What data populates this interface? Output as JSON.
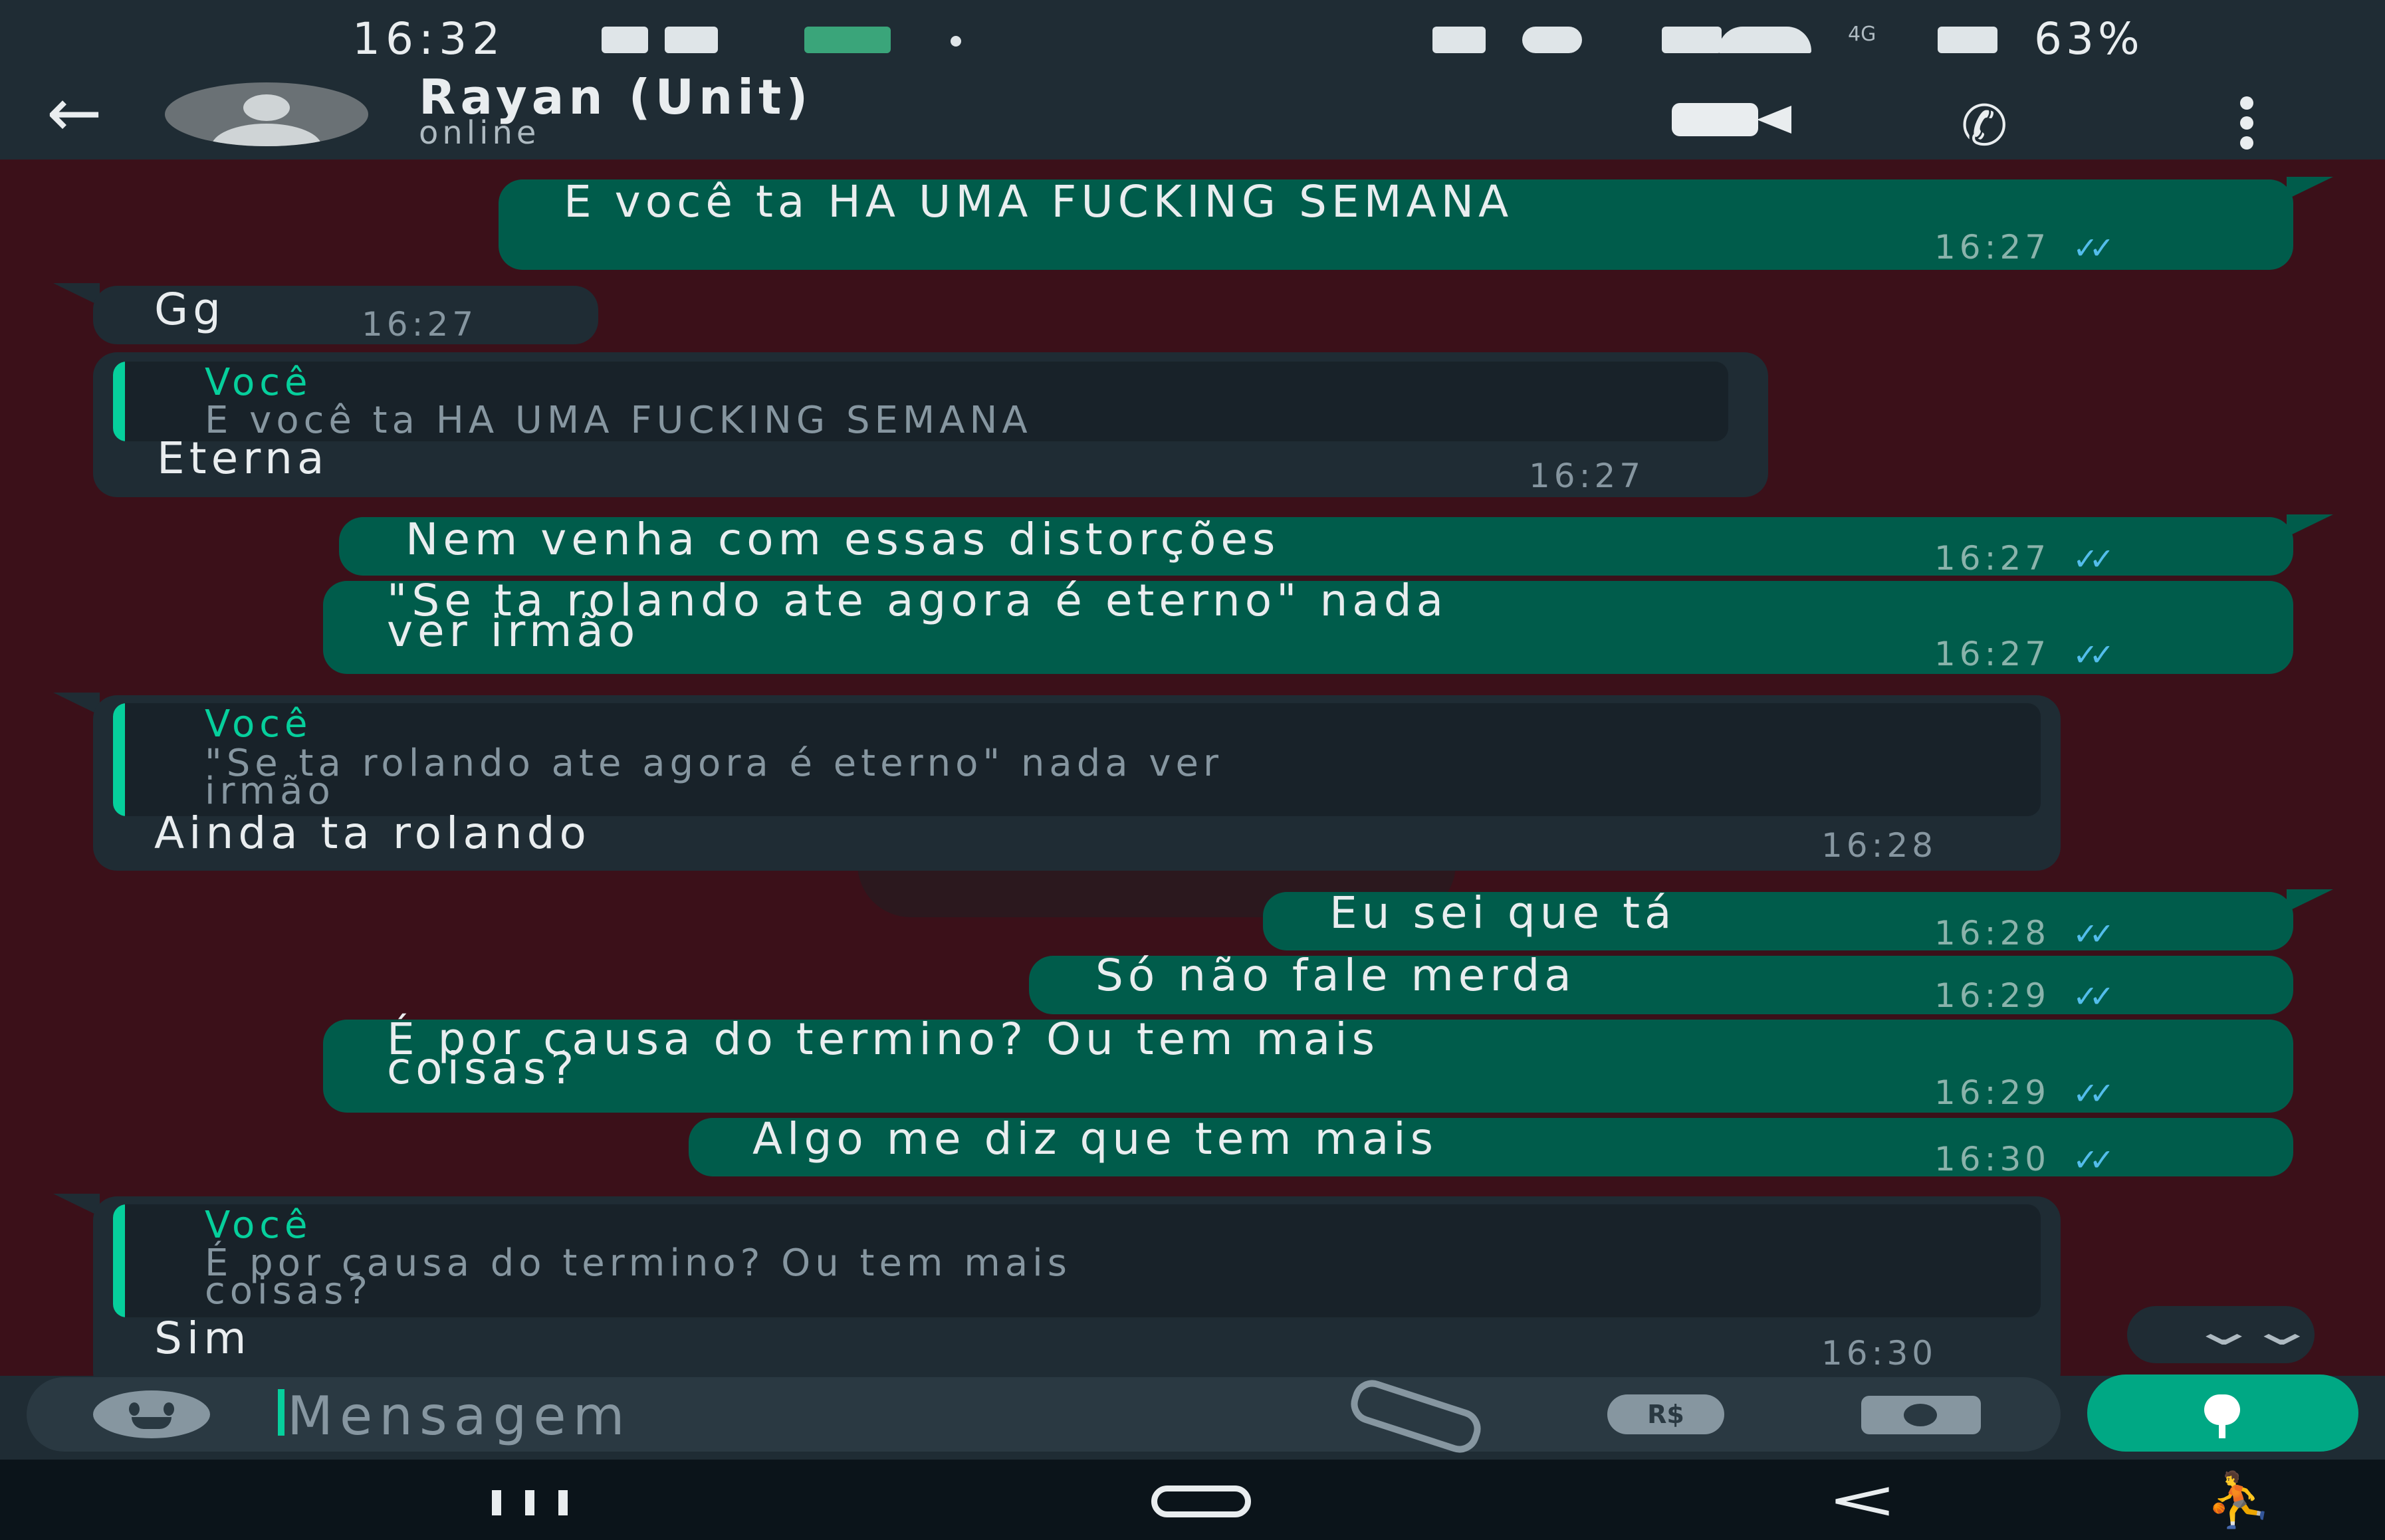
{
  "status_bar": {
    "time": "16:32",
    "network": "4G",
    "battery": "63%"
  },
  "header": {
    "contact_name": "Rayan (Unit)",
    "contact_status": "online"
  },
  "messages": [
    {
      "direction": "out",
      "text": "E você ta HA UMA FUCKING SEMANA",
      "time": "16:27",
      "status": "read"
    },
    {
      "direction": "in",
      "text": "Gg",
      "time": "16:27"
    },
    {
      "direction": "in",
      "quote": {
        "author": "Você",
        "text": "E você ta HA UMA FUCKING SEMANA"
      },
      "text": "Eterna",
      "time": "16:27"
    },
    {
      "direction": "out",
      "text": "Nem venha com essas distorções",
      "time": "16:27",
      "status": "read"
    },
    {
      "direction": "out",
      "text_lines": [
        "\"Se ta rolando ate agora é eterno\" nada",
        "ver irmão"
      ],
      "time": "16:27",
      "status": "read"
    },
    {
      "direction": "in",
      "quote": {
        "author": "Você",
        "text_lines": [
          "\"Se ta rolando ate agora é eterno\" nada ver",
          "irmão"
        ]
      },
      "text": "Ainda ta rolando",
      "time": "16:28"
    },
    {
      "direction": "out",
      "text": "Eu sei que tá",
      "time": "16:28",
      "status": "read"
    },
    {
      "direction": "out",
      "text": "Só não fale merda",
      "time": "16:29",
      "status": "read"
    },
    {
      "direction": "out",
      "text_lines": [
        "É por causa do termino? Ou tem mais",
        "coisas?"
      ],
      "time": "16:29",
      "status": "read"
    },
    {
      "direction": "out",
      "text": "Algo me diz que tem mais",
      "time": "16:30",
      "status": "read"
    },
    {
      "direction": "in",
      "quote": {
        "author": "Você",
        "text_lines": [
          "É por causa do termino? Ou tem mais",
          "coisas?"
        ]
      },
      "text": "Sim",
      "time": "16:30"
    }
  ],
  "input": {
    "placeholder": "Mensagem",
    "value": ""
  },
  "icons": {
    "back": "arrow-left-icon",
    "video": "video-call-icon",
    "call": "phone-icon",
    "menu": "more-vert-icon",
    "emoji": "emoji-icon",
    "attach": "paperclip-icon",
    "payment": "pix-payment-icon",
    "camera": "camera-icon",
    "mic": "mic-icon",
    "scroll": "double-chevron-down-icon"
  },
  "payment_icon_label": "R$",
  "colors": {
    "header_bg": "#1f2c34",
    "chat_wallpaper": "#3b1019",
    "outgoing_bubble": "#005c4b",
    "incoming_bubble": "#1f2c34",
    "accent": "#00a884",
    "read_ticks": "#53bdeb"
  }
}
